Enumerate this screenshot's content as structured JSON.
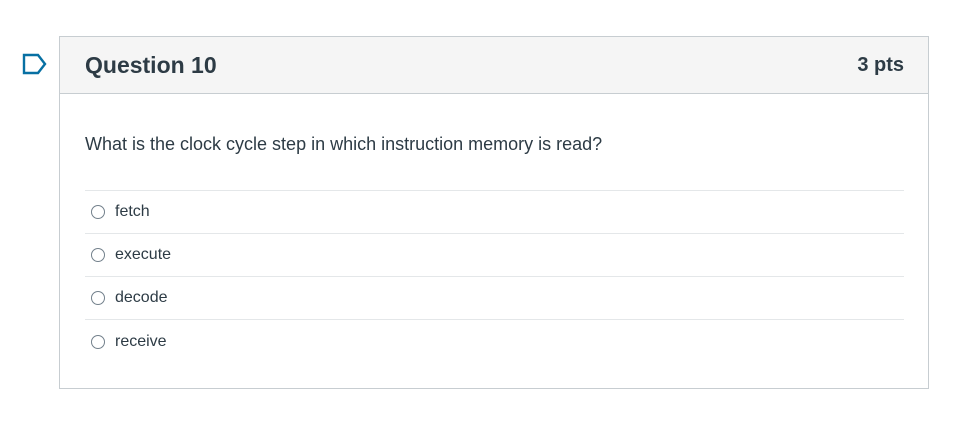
{
  "question": {
    "title": "Question 10",
    "points": "3 pts",
    "text": "What is the clock cycle step in which instruction memory is read?",
    "answers": [
      {
        "label": "fetch"
      },
      {
        "label": "execute"
      },
      {
        "label": "decode"
      },
      {
        "label": "receive"
      }
    ]
  },
  "icons": {
    "flag": "flag-question-icon"
  },
  "colors": {
    "flag_accent": "#0770a3",
    "header_bg": "#f5f5f5",
    "text": "#2d3b45",
    "border": "#c7cdd1"
  }
}
